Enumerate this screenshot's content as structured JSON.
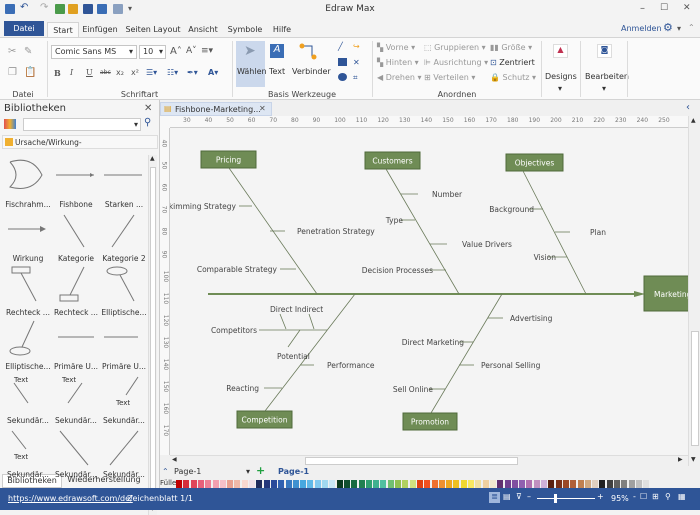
{
  "app": {
    "title": "Edraw Max",
    "window_controls": [
      "minimize",
      "maximize",
      "close"
    ]
  },
  "quick_access": {
    "icons": [
      "app-icon",
      "undo-icon",
      "redo-icon",
      "new-icon",
      "open-icon",
      "save-icon",
      "print-icon",
      "export-icon",
      "customize-icon"
    ]
  },
  "menu": {
    "file": "Datei",
    "tabs": [
      "Start",
      "Einfügen",
      "Seiten Layout",
      "Ansicht",
      "Symbole",
      "Hilfe"
    ],
    "active": "Start",
    "login": "Anmelden"
  },
  "ribbon": {
    "datei": {
      "label": "Datei"
    },
    "font": {
      "label": "Schriftart",
      "family": "Comic Sans MS",
      "size": "10",
      "format_buttons": [
        "B",
        "I",
        "U",
        "abc",
        "x₂",
        "x²"
      ]
    },
    "tools": {
      "label": "Basis Werkzeuge",
      "select": "Wählen",
      "text": "Text",
      "connector": "Verbinder"
    },
    "arrange": {
      "label": "Anordnen",
      "items": [
        [
          "Vorne",
          "Hinten",
          "Drehen"
        ],
        [
          "Gruppieren",
          "Ausrichtung",
          "Verteilen"
        ],
        [
          "Größe",
          "Zentriert",
          "Schutz"
        ]
      ]
    },
    "designs": "Designs",
    "edit": "Bearbeiten"
  },
  "library": {
    "title": "Bibliotheken",
    "search_placeholder": "",
    "category": "Ursache/Wirkung-Diagramm(Fischgräte",
    "shapes": [
      "Fischrahm...",
      "Fishbone",
      "Starken ...",
      "Wirkung",
      "Kategorie",
      "Kategorie 2",
      "Rechteck ...",
      "Rechteck ...",
      "Elliptische...",
      "Elliptische...",
      "Primäre U...",
      "Primäre U...",
      "Sekundär...",
      "Sekundär...",
      "Sekundär...",
      "Sekundär...",
      "Sekundär...",
      "Sekundär..."
    ],
    "shape_text": "Text",
    "bottom_tabs": [
      "Bibliotheken",
      "Wiederherstellung"
    ]
  },
  "document": {
    "tab": "Fishbone-Marketing...",
    "ruler_h": [
      "30",
      "40",
      "50",
      "60",
      "70",
      "80",
      "90",
      "100",
      "110",
      "120",
      "130",
      "140",
      "150",
      "160",
      "170",
      "180",
      "190",
      "200",
      "210",
      "220",
      "230",
      "240",
      "250"
    ],
    "ruler_v": [
      "40",
      "50",
      "60",
      "70",
      "80",
      "90",
      "100",
      "110",
      "120",
      "130",
      "140",
      "150",
      "160",
      "170"
    ]
  },
  "diagram": {
    "effect": "Marketing",
    "box_color": "#6f8c55",
    "categories": [
      {
        "name": "Pricing",
        "causes": [
          "Skimming Strategy",
          "Penetration Strategy",
          "Comparable Strategy"
        ]
      },
      {
        "name": "Customers",
        "causes": [
          "Number",
          "Type",
          "Value Drivers",
          "Decision Processes"
        ]
      },
      {
        "name": "Objectives",
        "causes": [
          "Background",
          "Plan",
          "Vision"
        ]
      },
      {
        "name": "Competition",
        "causes": [
          "Competitors",
          "Direct Indirect",
          "Potential",
          "Performance",
          "Reacting"
        ]
      },
      {
        "name": "Promotion",
        "causes": [
          "Advertising",
          "Direct Marketing",
          "Personal Selling",
          "Sell Online"
        ]
      }
    ]
  },
  "pages": {
    "current": "Page-1",
    "tabs": [
      "Page-1"
    ],
    "fill_label": "Füller"
  },
  "palette": [
    "#c00000",
    "#d62d3a",
    "#e0455a",
    "#e8607a",
    "#ee8095",
    "#f2a0b0",
    "#f5c0c8",
    "#e9a090",
    "#f0b8a8",
    "#f8d8d0",
    "#f0e0e8",
    "#1f2a5a",
    "#23367a",
    "#2a4a9a",
    "#3060b0",
    "#3878c0",
    "#4090d0",
    "#48a8e0",
    "#60b8e8",
    "#80c8f0",
    "#a0d8f0",
    "#c8e8f8",
    "#0a3a20",
    "#105030",
    "#186a40",
    "#208050",
    "#30a070",
    "#40b090",
    "#50c0a0",
    "#70c070",
    "#90c050",
    "#b0d060",
    "#d0e080",
    "#e04010",
    "#f05020",
    "#f07030",
    "#f09030",
    "#f0a820",
    "#f0c020",
    "#f0d830",
    "#f8e860",
    "#f0e0a0",
    "#f0d0a0",
    "#f0e8d0",
    "#603070",
    "#704090",
    "#8050a0",
    "#9060b0",
    "#b070b0",
    "#c090c0",
    "#d0b0d8",
    "#5a2010",
    "#7a3018",
    "#9a4828",
    "#b06038",
    "#c08050",
    "#d0a880",
    "#e0d0c0",
    "#202020",
    "#404040",
    "#606060",
    "#808080",
    "#a0a0a0",
    "#c0c0c0",
    "#e0e0e0"
  ],
  "status": {
    "url": "https://www.edrawsoft.com/de/",
    "sheet": "Zeichenblatt 1/1",
    "zoom": "95%",
    "zoom_level": 0.3
  }
}
